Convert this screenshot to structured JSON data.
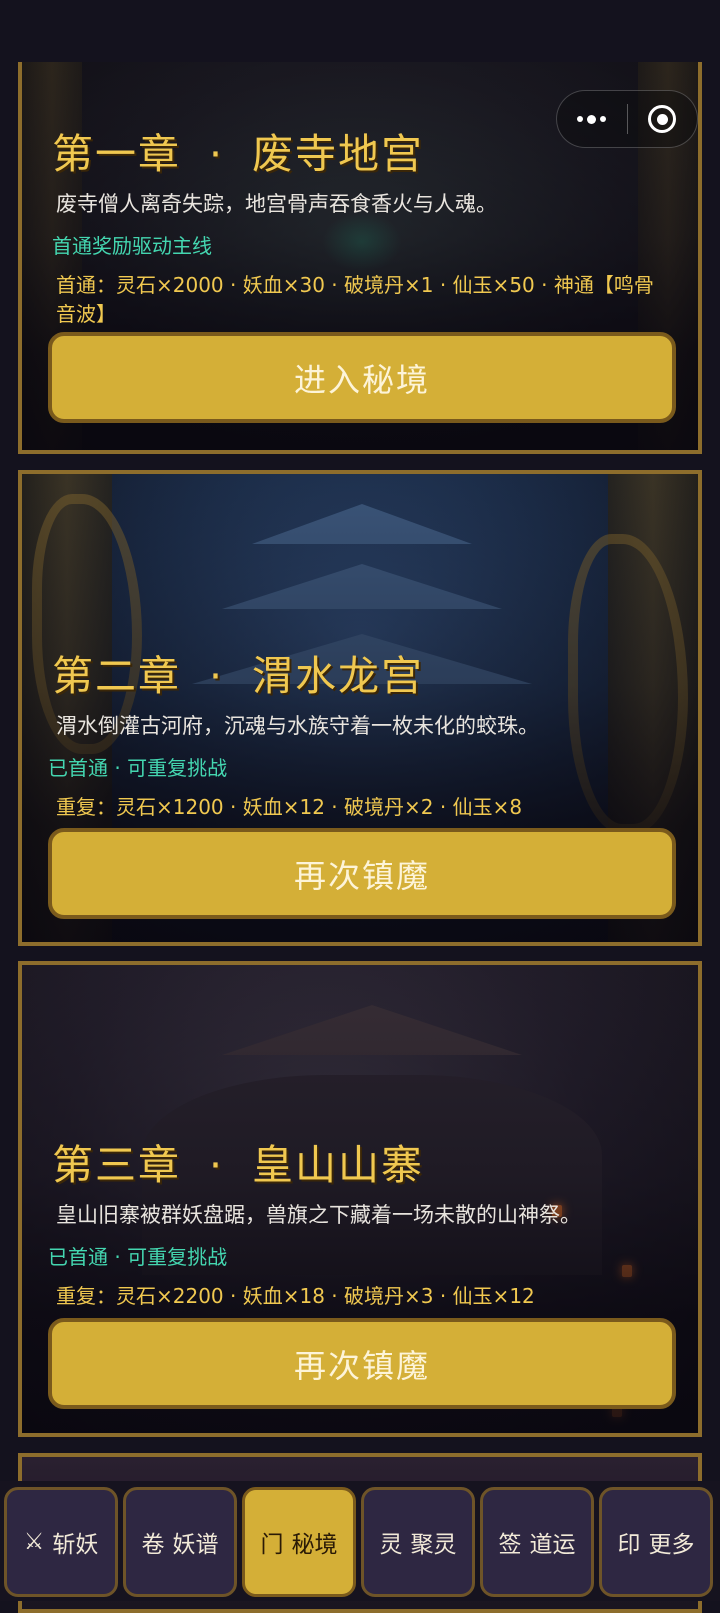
{
  "header": {
    "capsule": {
      "more_icon": "more-dots-icon",
      "close_icon": "target-icon"
    }
  },
  "chapters": [
    {
      "title": "第一章",
      "separator": "·",
      "name": "废寺地宫",
      "description": "废寺僧人离奇失踪，地宫骨声吞食香火与人魂。",
      "status": "首通奖励驱动主线",
      "reward": "首通：灵石×2000 · 妖血×30 · 破境丹×1 · 仙玉×50 · 神通【鸣骨音波】",
      "button": "进入秘境"
    },
    {
      "title": "第二章",
      "separator": "·",
      "name": "渭水龙宫",
      "description": "渭水倒灌古河府，沉魂与水族守着一枚未化的蛟珠。",
      "status": "已首通 · 可重复挑战",
      "reward": "重复：灵石×1200 · 妖血×12 · 破境丹×2 · 仙玉×8",
      "button": "再次镇魔"
    },
    {
      "title": "第三章",
      "separator": "·",
      "name": "皇山山寨",
      "description": "皇山旧寨被群妖盘踞，兽旗之下藏着一场未散的山神祭。",
      "status": "已首通 · 可重复挑战",
      "reward": "重复：灵石×2200 · 妖血×18 · 破境丹×3 · 仙玉×12",
      "button": "再次镇魔"
    }
  ],
  "tabs": [
    {
      "icon": "⚔",
      "label": "斩妖"
    },
    {
      "icon": "卷",
      "label": "妖谱"
    },
    {
      "icon": "门",
      "label": "秘境",
      "active": true
    },
    {
      "icon": "灵",
      "label": "聚灵"
    },
    {
      "icon": "签",
      "label": "道运"
    },
    {
      "icon": "印",
      "label": "更多"
    }
  ],
  "colors": {
    "accent_gold": "#d4af37",
    "title_gold": "#f0c850",
    "status_teal": "#44d6b0",
    "frame_brown": "#8d6d2c",
    "tab_bg": "#2e2742"
  }
}
